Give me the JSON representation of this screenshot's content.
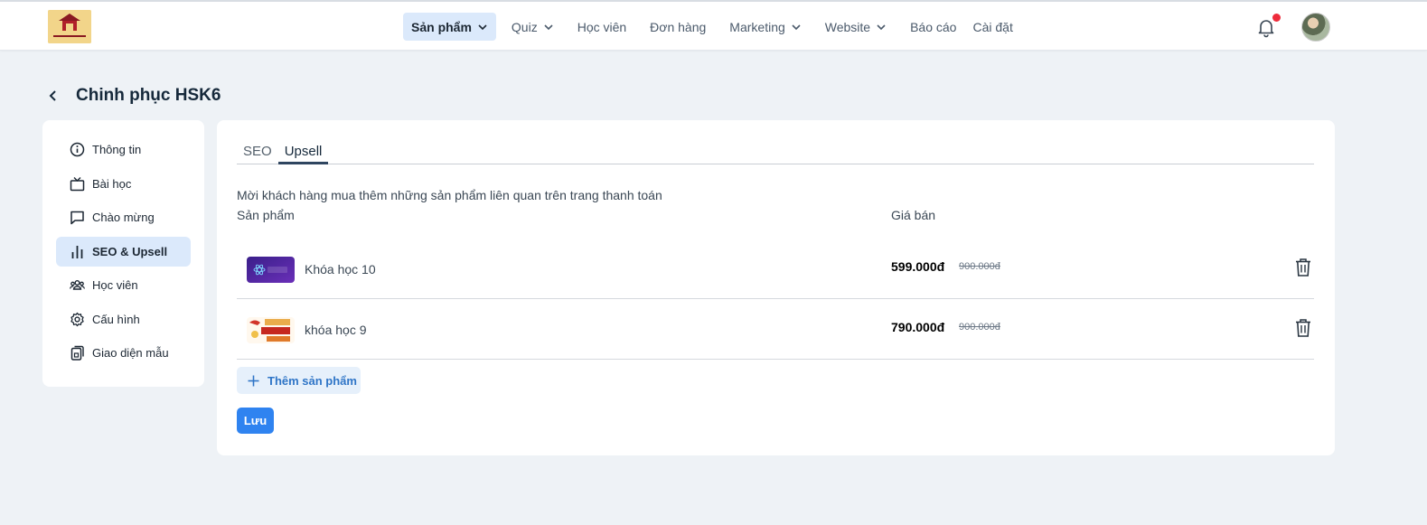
{
  "nav": {
    "items": [
      {
        "label": "Sản phẩm",
        "dropdown": true,
        "active": true
      },
      {
        "label": "Quiz",
        "dropdown": true
      },
      {
        "label": "Học viên",
        "dropdown": false
      },
      {
        "label": "Đơn hàng",
        "dropdown": false
      },
      {
        "label": "Marketing",
        "dropdown": true
      },
      {
        "label": "Website",
        "dropdown": true
      },
      {
        "label": "Báo cáo",
        "dropdown": false
      },
      {
        "label": "Cài đặt",
        "dropdown": false
      }
    ],
    "icons": {
      "notification": "bell-icon",
      "profile": "avatar"
    },
    "notification_dot_color": "#ee2b3b"
  },
  "page": {
    "title": "Chinh phục HSK6",
    "back_icon": "chevron-left-icon"
  },
  "sidebar": {
    "items": [
      {
        "label": "Thông tin",
        "icon": "info-icon"
      },
      {
        "label": "Bài học",
        "icon": "tv-icon"
      },
      {
        "label": "Chào mừng",
        "icon": "message-icon"
      },
      {
        "label": "SEO & Upsell",
        "icon": "bar-chart-icon",
        "active": true
      },
      {
        "label": "Học viên",
        "icon": "users-icon"
      },
      {
        "label": "Cấu hình",
        "icon": "gear-icon"
      },
      {
        "label": "Giao diện mẫu",
        "icon": "template-icon"
      }
    ]
  },
  "main": {
    "tabs": [
      {
        "label": "SEO"
      },
      {
        "label": "Upsell",
        "active": true
      }
    ],
    "description": "Mời khách hàng mua thêm những sản phẩm liên quan trên trang thanh toán",
    "columns": {
      "product": "Sản phẩm",
      "price": "Giá bán"
    },
    "products": [
      {
        "name": "Khóa học 10",
        "price": "599.000đ",
        "old_price": "900.000đ",
        "thumb_text": "React JS"
      },
      {
        "name": "khóa học 9",
        "price": "790.000đ",
        "old_price": "900.000đ",
        "thumb_text": "TIẾNG"
      }
    ],
    "add_label": "Thêm sản phẩm",
    "save_label": "Lưu"
  },
  "colors": {
    "accent": "#2f83f0",
    "active_bg": "#dbe9fb",
    "page_bg": "#eef2f6"
  }
}
